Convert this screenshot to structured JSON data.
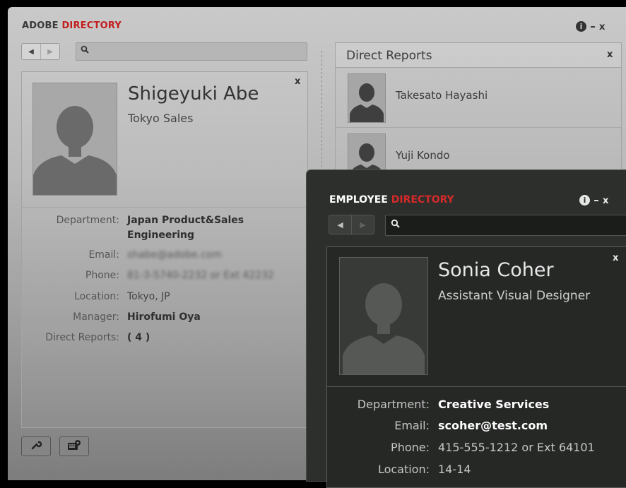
{
  "window_a": {
    "brand_prefix": "ADOBE",
    "brand_highlight": "DIRECTORY",
    "controls": {
      "info": "i",
      "minimize": "–",
      "close": "x"
    },
    "nav": {
      "back": "◀",
      "forward": "▶"
    },
    "search": {
      "icon": "search-icon",
      "placeholder": ""
    },
    "card": {
      "close": "x",
      "name": "Shigeyuki Abe",
      "role": "Tokyo Sales",
      "details": [
        {
          "label": "Department:",
          "value": "Japan Product&Sales",
          "value2": "Engineering"
        },
        {
          "label": "Email:",
          "value": "shabe@adobe.com"
        },
        {
          "label": "Phone:",
          "value": "81-3-5740-2232 or Ext 42232"
        },
        {
          "label": "Location:",
          "value": "Tokyo, JP"
        },
        {
          "label": "Manager:",
          "value": "Hirofumi Oya"
        },
        {
          "label": "Direct Reports:",
          "value": "( 4 )"
        }
      ]
    },
    "direct_reports": {
      "title": "Direct Reports",
      "close": "x",
      "items": [
        {
          "name": "Takesato Hayashi"
        },
        {
          "name": "Yuji Kondo"
        }
      ]
    },
    "bottom_bar": {
      "tools_icon": "wrench-icon",
      "keyboard_icon": "keyboard-settings-icon"
    }
  },
  "window_b": {
    "brand_prefix": "EMPLOYEE",
    "brand_highlight": "DIRECTORY",
    "controls": {
      "info": "i",
      "minimize": "–",
      "close": "x"
    },
    "nav": {
      "back": "◀",
      "forward": "▶"
    },
    "search": {
      "icon": "search-icon",
      "placeholder": ""
    },
    "card": {
      "close": "x",
      "name": "Sonia Coher",
      "role": "Assistant Visual Designer",
      "details": [
        {
          "label": "Department:",
          "value": "Creative Services"
        },
        {
          "label": "Email:",
          "value": "scoher@test.com"
        },
        {
          "label": "Phone:",
          "value": "415-555-1212 or Ext 64101"
        },
        {
          "label": "Location:",
          "value": "14-14"
        }
      ]
    }
  },
  "colors": {
    "brand_red_light": "#c21e1e",
    "brand_red_dark": "#d62a2a",
    "dark_window_bg": "#2c2f2c",
    "light_window_bg": "#c9c9c9"
  }
}
